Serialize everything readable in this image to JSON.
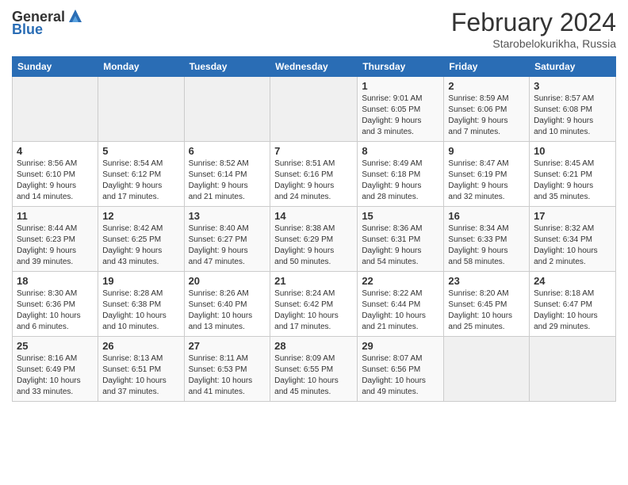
{
  "header": {
    "logo": {
      "general": "General",
      "blue": "Blue",
      "tagline": ""
    },
    "title": "February 2024",
    "location": "Starobelokurikha, Russia"
  },
  "days_of_week": [
    "Sunday",
    "Monday",
    "Tuesday",
    "Wednesday",
    "Thursday",
    "Friday",
    "Saturday"
  ],
  "weeks": [
    [
      {
        "day": "",
        "info": ""
      },
      {
        "day": "",
        "info": ""
      },
      {
        "day": "",
        "info": ""
      },
      {
        "day": "",
        "info": ""
      },
      {
        "day": "1",
        "info": "Sunrise: 9:01 AM\nSunset: 6:05 PM\nDaylight: 9 hours\nand 3 minutes."
      },
      {
        "day": "2",
        "info": "Sunrise: 8:59 AM\nSunset: 6:06 PM\nDaylight: 9 hours\nand 7 minutes."
      },
      {
        "day": "3",
        "info": "Sunrise: 8:57 AM\nSunset: 6:08 PM\nDaylight: 9 hours\nand 10 minutes."
      }
    ],
    [
      {
        "day": "4",
        "info": "Sunrise: 8:56 AM\nSunset: 6:10 PM\nDaylight: 9 hours\nand 14 minutes."
      },
      {
        "day": "5",
        "info": "Sunrise: 8:54 AM\nSunset: 6:12 PM\nDaylight: 9 hours\nand 17 minutes."
      },
      {
        "day": "6",
        "info": "Sunrise: 8:52 AM\nSunset: 6:14 PM\nDaylight: 9 hours\nand 21 minutes."
      },
      {
        "day": "7",
        "info": "Sunrise: 8:51 AM\nSunset: 6:16 PM\nDaylight: 9 hours\nand 24 minutes."
      },
      {
        "day": "8",
        "info": "Sunrise: 8:49 AM\nSunset: 6:18 PM\nDaylight: 9 hours\nand 28 minutes."
      },
      {
        "day": "9",
        "info": "Sunrise: 8:47 AM\nSunset: 6:19 PM\nDaylight: 9 hours\nand 32 minutes."
      },
      {
        "day": "10",
        "info": "Sunrise: 8:45 AM\nSunset: 6:21 PM\nDaylight: 9 hours\nand 35 minutes."
      }
    ],
    [
      {
        "day": "11",
        "info": "Sunrise: 8:44 AM\nSunset: 6:23 PM\nDaylight: 9 hours\nand 39 minutes."
      },
      {
        "day": "12",
        "info": "Sunrise: 8:42 AM\nSunset: 6:25 PM\nDaylight: 9 hours\nand 43 minutes."
      },
      {
        "day": "13",
        "info": "Sunrise: 8:40 AM\nSunset: 6:27 PM\nDaylight: 9 hours\nand 47 minutes."
      },
      {
        "day": "14",
        "info": "Sunrise: 8:38 AM\nSunset: 6:29 PM\nDaylight: 9 hours\nand 50 minutes."
      },
      {
        "day": "15",
        "info": "Sunrise: 8:36 AM\nSunset: 6:31 PM\nDaylight: 9 hours\nand 54 minutes."
      },
      {
        "day": "16",
        "info": "Sunrise: 8:34 AM\nSunset: 6:33 PM\nDaylight: 9 hours\nand 58 minutes."
      },
      {
        "day": "17",
        "info": "Sunrise: 8:32 AM\nSunset: 6:34 PM\nDaylight: 10 hours\nand 2 minutes."
      }
    ],
    [
      {
        "day": "18",
        "info": "Sunrise: 8:30 AM\nSunset: 6:36 PM\nDaylight: 10 hours\nand 6 minutes."
      },
      {
        "day": "19",
        "info": "Sunrise: 8:28 AM\nSunset: 6:38 PM\nDaylight: 10 hours\nand 10 minutes."
      },
      {
        "day": "20",
        "info": "Sunrise: 8:26 AM\nSunset: 6:40 PM\nDaylight: 10 hours\nand 13 minutes."
      },
      {
        "day": "21",
        "info": "Sunrise: 8:24 AM\nSunset: 6:42 PM\nDaylight: 10 hours\nand 17 minutes."
      },
      {
        "day": "22",
        "info": "Sunrise: 8:22 AM\nSunset: 6:44 PM\nDaylight: 10 hours\nand 21 minutes."
      },
      {
        "day": "23",
        "info": "Sunrise: 8:20 AM\nSunset: 6:45 PM\nDaylight: 10 hours\nand 25 minutes."
      },
      {
        "day": "24",
        "info": "Sunrise: 8:18 AM\nSunset: 6:47 PM\nDaylight: 10 hours\nand 29 minutes."
      }
    ],
    [
      {
        "day": "25",
        "info": "Sunrise: 8:16 AM\nSunset: 6:49 PM\nDaylight: 10 hours\nand 33 minutes."
      },
      {
        "day": "26",
        "info": "Sunrise: 8:13 AM\nSunset: 6:51 PM\nDaylight: 10 hours\nand 37 minutes."
      },
      {
        "day": "27",
        "info": "Sunrise: 8:11 AM\nSunset: 6:53 PM\nDaylight: 10 hours\nand 41 minutes."
      },
      {
        "day": "28",
        "info": "Sunrise: 8:09 AM\nSunset: 6:55 PM\nDaylight: 10 hours\nand 45 minutes."
      },
      {
        "day": "29",
        "info": "Sunrise: 8:07 AM\nSunset: 6:56 PM\nDaylight: 10 hours\nand 49 minutes."
      },
      {
        "day": "",
        "info": ""
      },
      {
        "day": "",
        "info": ""
      }
    ]
  ]
}
